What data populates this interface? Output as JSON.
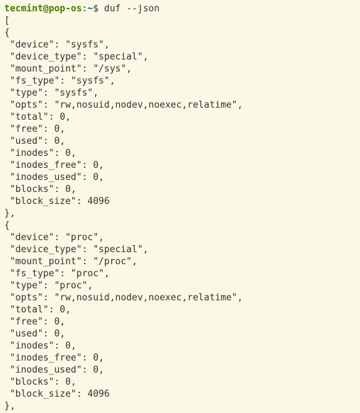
{
  "prompt": {
    "user": "tecmint",
    "at": "@",
    "host": "pop-os",
    "colon": ":",
    "path": "~",
    "symbol": "$ ",
    "command": "duf --json"
  },
  "output": {
    "open_bracket": "[",
    "close_of_first": "},",
    "close_of_second": "},",
    "obj1": {
      "open": "{",
      "lines": [
        " \"device\": \"sysfs\",",
        " \"device_type\": \"special\",",
        " \"mount_point\": \"/sys\",",
        " \"fs_type\": \"sysfs\",",
        " \"type\": \"sysfs\",",
        " \"opts\": \"rw,nosuid,nodev,noexec,relatime\",",
        " \"total\": 0,",
        " \"free\": 0,",
        " \"used\": 0,",
        " \"inodes\": 0,",
        " \"inodes_free\": 0,",
        " \"inodes_used\": 0,",
        " \"blocks\": 0,",
        " \"block_size\": 4096"
      ]
    },
    "obj2": {
      "open": "{",
      "lines": [
        " \"device\": \"proc\",",
        " \"device_type\": \"special\",",
        " \"mount_point\": \"/proc\",",
        " \"fs_type\": \"proc\",",
        " \"type\": \"proc\",",
        " \"opts\": \"rw,nosuid,nodev,noexec,relatime\",",
        " \"total\": 0,",
        " \"free\": 0,",
        " \"used\": 0,",
        " \"inodes\": 0,",
        " \"inodes_free\": 0,",
        " \"inodes_used\": 0,",
        " \"blocks\": 0,",
        " \"block_size\": 4096"
      ]
    }
  }
}
